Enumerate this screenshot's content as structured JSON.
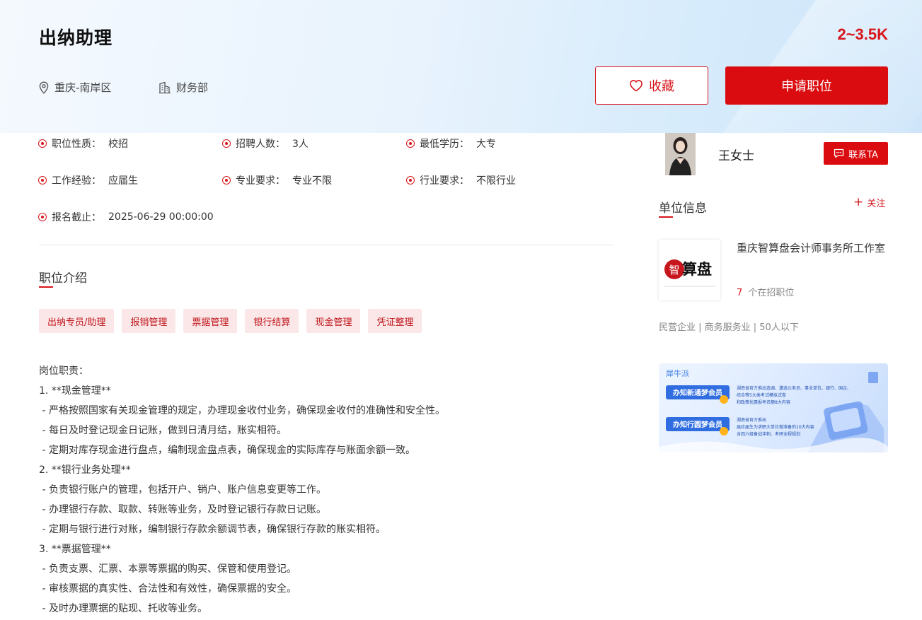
{
  "job": {
    "title": "出纳助理",
    "salary": "2~3.5K",
    "location": "重庆-南岸区",
    "department": "财务部",
    "favorite_label": "收藏",
    "apply_label": "申请职位"
  },
  "attributes": [
    {
      "label": "职位性质：",
      "value": "校招"
    },
    {
      "label": "招聘人数：",
      "value": "3人"
    },
    {
      "label": "最低学历：",
      "value": "大专"
    },
    {
      "label": "工作经验：",
      "value": "应届生"
    },
    {
      "label": "专业要求：",
      "value": "专业不限"
    },
    {
      "label": "行业要求：",
      "value": "不限行业"
    },
    {
      "label": "报名截止：",
      "value": "2025-06-29 00:00:00"
    }
  ],
  "intro": {
    "title": "职位介绍",
    "tags": [
      "出纳专员/助理",
      "报销管理",
      "票据管理",
      "银行结算",
      "现金管理",
      "凭证整理"
    ],
    "lines": [
      "岗位职责：",
      "1. **现金管理**",
      " - 严格按照国家有关现金管理的规定，办理现金收付业务，确保现金收付的准确性和安全性。",
      " - 每日及时登记现金日记账，做到日清月结，账实相符。",
      " - 定期对库存现金进行盘点，编制现金盘点表，确保现金的实际库存与账面余额一致。",
      "2. **银行业务处理**",
      " - 负责银行账户的管理，包括开户、销户、账户信息变更等工作。",
      " - 办理银行存款、取款、转账等业务，及时登记银行存款日记账。",
      " - 定期与银行进行对账，编制银行存款余额调节表，确保银行存款的账实相符。",
      "3. **票据管理**",
      " - 负责支票、汇票、本票等票据的购买、保管和使用登记。",
      " - 审核票据的真实性、合法性和有效性，确保票据的安全。",
      " - 及时办理票据的贴现、托收等业务。"
    ]
  },
  "recruiter": {
    "name": "王女士",
    "contact_label": "联系TA"
  },
  "company": {
    "section_title": "单位信息",
    "follow_label": "关注",
    "name": "重庆智算盘会计师事务所工作室",
    "logo_text": "智算盘",
    "open_jobs_count": "7",
    "open_jobs_label": "个在招职位",
    "meta": "民营企业 | 商务服务业 | 50人以下"
  },
  "banner": {
    "brand": "犀牛派",
    "badge1": "办知新通梦会员",
    "line1a": "湖南省官方推出选调、遴选公务员、事业单位、银行、国企、",
    "line1b": "综合等5大类考试模拟试卷",
    "line1c": "和政策优惠报考名额8大内容",
    "badge2": "办知行圆梦会员",
    "line2a": "湖南省官方推出",
    "line2b": "届应届生为求职大单位做准备的10大内容",
    "line2c": "含四六级备战冲刺、考研全程规划"
  },
  "colors": {
    "accent": "#db0c10",
    "tag_bg": "#fbe7e8"
  }
}
